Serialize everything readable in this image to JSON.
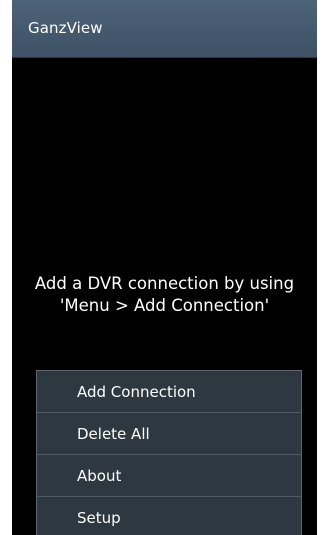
{
  "app": {
    "title": "GanzView"
  },
  "main": {
    "empty_message_line1": "Add a DVR connection by using",
    "empty_message_line2": "'Menu > Add Connection'"
  },
  "menu": {
    "items": [
      {
        "label": "Add Connection"
      },
      {
        "label": "Delete All"
      },
      {
        "label": "About"
      },
      {
        "label": "Setup"
      }
    ]
  },
  "colors": {
    "titlebar": "#455a6e",
    "background": "#000000",
    "menu_background": "#2e3841",
    "text": "#ffffff"
  }
}
